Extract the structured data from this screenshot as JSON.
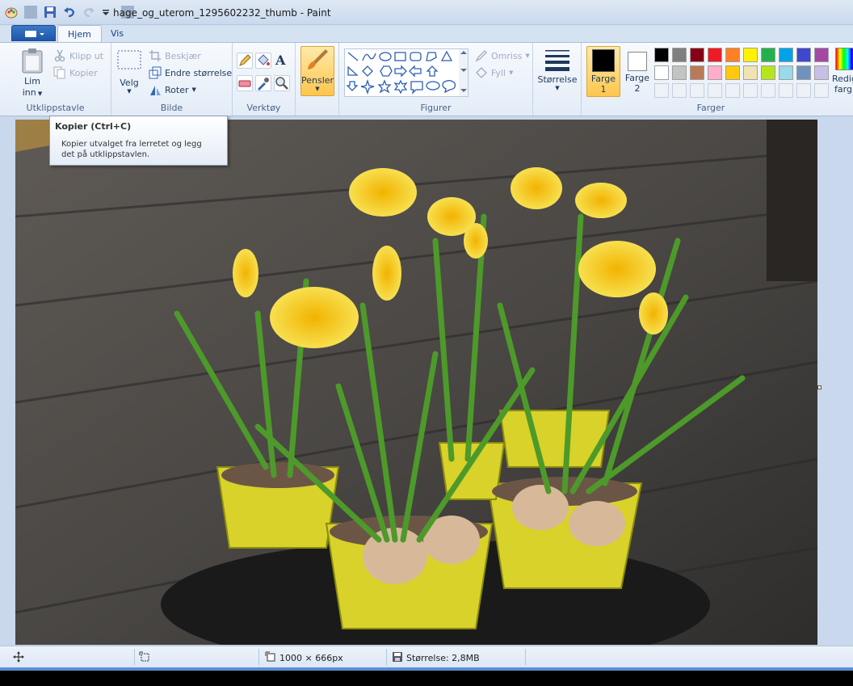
{
  "window": {
    "title": "hage_og_uterom_1295602232_thumb - Paint"
  },
  "tabs": [
    {
      "label": "Hjem"
    },
    {
      "label": "Vis"
    }
  ],
  "ribbon": {
    "clipboard": {
      "group_label": "Utklippstavle",
      "paste_label_line1": "Lim",
      "paste_label_line2": "inn",
      "cut_label": "Klipp ut",
      "copy_label": "Kopier"
    },
    "image": {
      "group_label": "Bilde",
      "select_label": "Velg",
      "crop_label": "Beskjær",
      "resize_label": "Endre størrelse",
      "rotate_label": "Roter"
    },
    "tools": {
      "group_label": "Verktøy"
    },
    "brushes": {
      "label": "Pensler"
    },
    "shapes": {
      "group_label": "Figurer",
      "outline_label": "Omriss",
      "fill_label": "Fyll"
    },
    "size": {
      "label": "Størrelse"
    },
    "colors": {
      "group_label": "Farger",
      "color1_line1": "Farge",
      "color1_line2": "1",
      "color2_line1": "Farge",
      "color2_line2": "2",
      "edit_line1": "Redig",
      "edit_line2": "farg",
      "color1": "#000000",
      "color2": "#ffffff",
      "palette_row1": [
        "#000000",
        "#7f7f7f",
        "#880015",
        "#ed1c24",
        "#ff7f27",
        "#fff200",
        "#22b14c",
        "#00a2e8",
        "#3f48cc",
        "#a349a4"
      ],
      "palette_row2": [
        "#ffffff",
        "#c3c3c3",
        "#b97a57",
        "#ffaec9",
        "#ffc90e",
        "#efe4b0",
        "#b5e61d",
        "#99d9ea",
        "#7092be",
        "#c8bfe7"
      ]
    }
  },
  "tooltip": {
    "title": "Kopier (Ctrl+C)",
    "body_line1": "Kopier utvalget fra lerretet og legg",
    "body_line2": "det på utklippstavlen."
  },
  "status": {
    "dimensions": "1000 × 666px",
    "file_size": "Størrelse: 2,8MB"
  }
}
